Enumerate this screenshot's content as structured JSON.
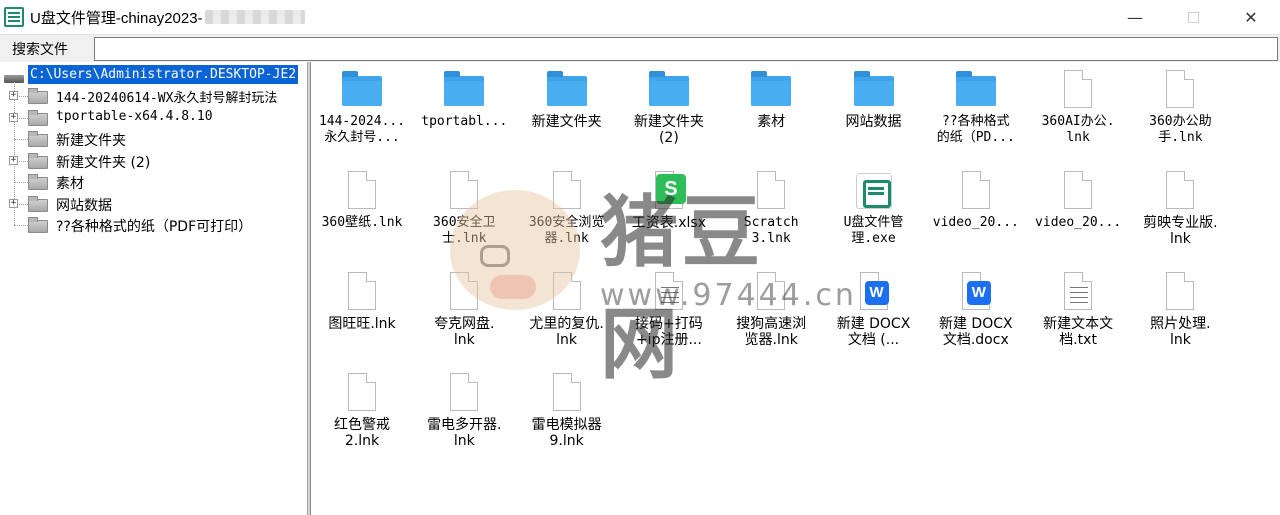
{
  "window": {
    "title": "U盘文件管理-chinay2023-",
    "minimize": "—",
    "close": "✕"
  },
  "toolbar": {
    "search_label": "搜索文件",
    "search_value": ""
  },
  "tree": {
    "root": "C:\\Users\\Administrator.DESKTOP-JE2",
    "items": [
      {
        "label": "144-20240614-WX永久封号解封玩法",
        "expandable": true
      },
      {
        "label": "tportable-x64.4.8.10",
        "expandable": true
      },
      {
        "label": "新建文件夹",
        "expandable": false
      },
      {
        "label": "新建文件夹 (2)",
        "expandable": true
      },
      {
        "label": "素材",
        "expandable": false
      },
      {
        "label": "网站数据",
        "expandable": true
      },
      {
        "label": "??各种格式的纸（PDF可打印）",
        "expandable": false
      }
    ]
  },
  "files": [
    {
      "name": "144-2024...\n永久封号...",
      "type": "folder"
    },
    {
      "name": "tportabl...",
      "type": "folder"
    },
    {
      "name": "新建文件夹",
      "type": "folder"
    },
    {
      "name": "新建文件夹\n(2)",
      "type": "folder"
    },
    {
      "name": "素材",
      "type": "folder"
    },
    {
      "name": "网站数据",
      "type": "folder"
    },
    {
      "name": "??各种格式\n的纸（PD...",
      "type": "folder"
    },
    {
      "name": "360AI办公.\nlnk",
      "type": "file"
    },
    {
      "name": "360办公助\n手.lnk",
      "type": "file"
    },
    {
      "name": "360壁纸.lnk",
      "type": "file"
    },
    {
      "name": "360安全卫\n士.lnk",
      "type": "file"
    },
    {
      "name": "360安全浏览\n器.lnk",
      "type": "file"
    },
    {
      "name": "工资表.xlsx",
      "type": "xlsx"
    },
    {
      "name": "Scratch\n3.lnk",
      "type": "file"
    },
    {
      "name": "U盘文件管\n理.exe",
      "type": "exe"
    },
    {
      "name": "video_20...",
      "type": "file"
    },
    {
      "name": "video_20...",
      "type": "file"
    },
    {
      "name": "剪映专业版.\nlnk",
      "type": "file"
    },
    {
      "name": "图旺旺.lnk",
      "type": "file"
    },
    {
      "name": "夸克网盘.\nlnk",
      "type": "file"
    },
    {
      "name": "尤里的复仇.\nlnk",
      "type": "file"
    },
    {
      "name": "接码+打码\n+ip注册...",
      "type": "txt"
    },
    {
      "name": "搜狗高速浏\n览器.lnk",
      "type": "file"
    },
    {
      "name": "新建 DOCX\n文档 (...",
      "type": "docx"
    },
    {
      "name": "新建 DOCX\n文档.docx",
      "type": "docx"
    },
    {
      "name": "新建文本文\n档.txt",
      "type": "txt"
    },
    {
      "name": "照片处理.\nlnk",
      "type": "file"
    },
    {
      "name": "红色警戒\n2.lnk",
      "type": "file"
    },
    {
      "name": "雷电多开器.\nlnk",
      "type": "file"
    },
    {
      "name": "雷电模拟器\n9.lnk",
      "type": "file"
    }
  ],
  "icons": {
    "xlsx_glyph": "S",
    "docx_glyph": "W"
  },
  "watermark": {
    "title": "猪豆网",
    "url": "www.97444.cn"
  },
  "colors": {
    "selection": "#0a64d6",
    "folder": "#3fa4ec",
    "xlsx": "#2ebd59",
    "docx": "#1d6ff2",
    "app_green": "#1d8a6c"
  }
}
